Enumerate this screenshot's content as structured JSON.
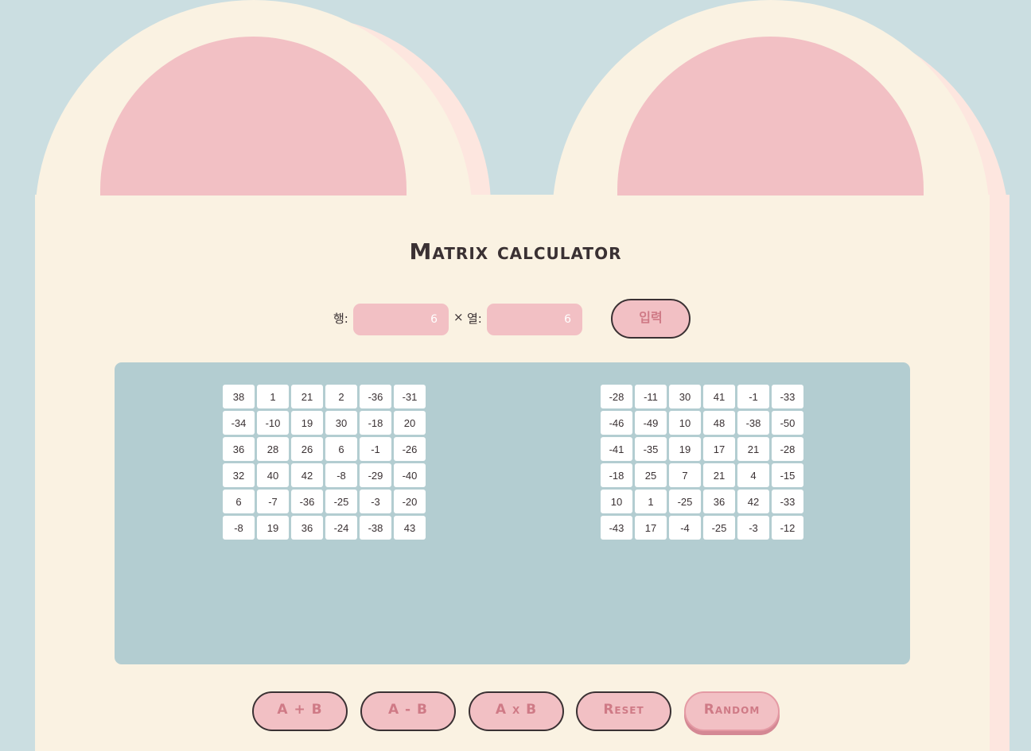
{
  "app": {
    "title": "Matrix calculator"
  },
  "colors": {
    "background": "#cbdee1",
    "cream": "#faf2e2",
    "shadow": "#fde6df",
    "pink": "#f2c0c4",
    "text_pink": "#cf7a86",
    "panel": "#b3cdd1",
    "dark": "#3a3133"
  },
  "dimensions": {
    "row_label": "행:",
    "row_value": "6",
    "times": "×",
    "col_label": "열:",
    "col_value": "6",
    "submit_label": "입력"
  },
  "matrix_a": [
    [
      "38",
      "1",
      "21",
      "2",
      "-36",
      "-31"
    ],
    [
      "-34",
      "-10",
      "19",
      "30",
      "-18",
      "20"
    ],
    [
      "36",
      "28",
      "26",
      "6",
      "-1",
      "-26"
    ],
    [
      "32",
      "40",
      "42",
      "-8",
      "-29",
      "-40"
    ],
    [
      "6",
      "-7",
      "-36",
      "-25",
      "-3",
      "-20"
    ],
    [
      "-8",
      "19",
      "36",
      "-24",
      "-38",
      "43"
    ]
  ],
  "matrix_b": [
    [
      "-28",
      "-11",
      "30",
      "41",
      "-1",
      "-33"
    ],
    [
      "-46",
      "-49",
      "10",
      "48",
      "-38",
      "-50"
    ],
    [
      "-41",
      "-35",
      "19",
      "17",
      "21",
      "-28"
    ],
    [
      "-18",
      "25",
      "7",
      "21",
      "4",
      "-15"
    ],
    [
      "10",
      "1",
      "-25",
      "36",
      "42",
      "-33"
    ],
    [
      "-43",
      "17",
      "-4",
      "-25",
      "-3",
      "-12"
    ]
  ],
  "operations": {
    "add_label": "A + B",
    "subtract_label": "A - B",
    "multiply_label": "A x B",
    "reset_label": "Reset",
    "random_label": "Random"
  }
}
